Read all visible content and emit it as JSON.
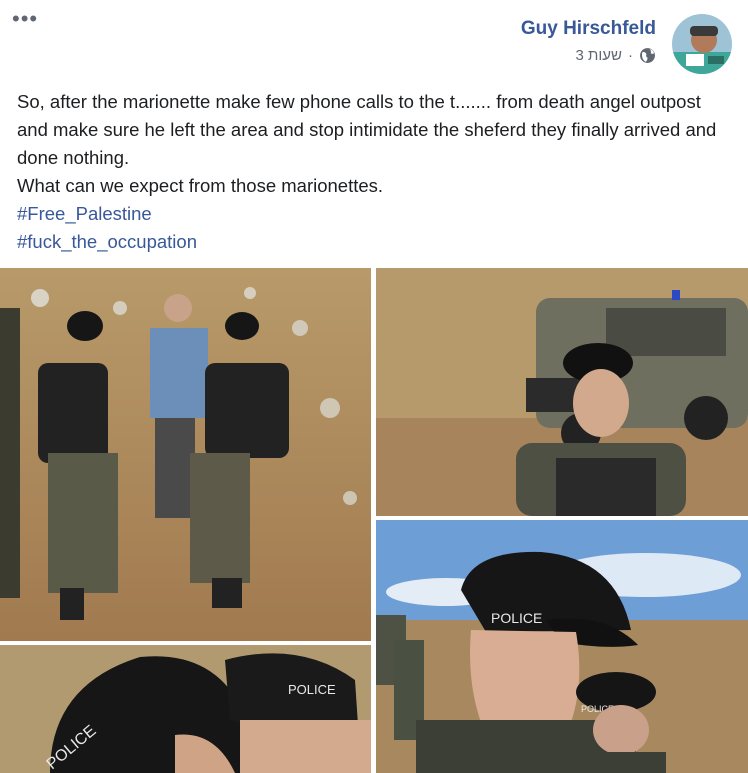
{
  "post": {
    "author": "Guy Hirschfeld",
    "time": "3 שעות",
    "dot": "·",
    "more": "•••",
    "body": [
      "So, after the marionette make few phone calls to the t....... from death angel outpost and make sure he left the area and stop intimidate the sheferd they finally arrived and done nothing.",
      "What can we expect from those marionettes."
    ],
    "hashtags": [
      "#Free_Palestine",
      "#fuck_the_occupation"
    ]
  },
  "photos": {
    "cap_text_1": "POLICE",
    "cap_text_2": "POLICE",
    "cap_text_3": "POLICE",
    "cap_text_4": "POLICE"
  },
  "icons": {
    "privacy": "globe-icon",
    "menu": "more-options-icon"
  },
  "colors": {
    "link": "#385898",
    "meta": "#606770",
    "text": "#1c1e21"
  }
}
